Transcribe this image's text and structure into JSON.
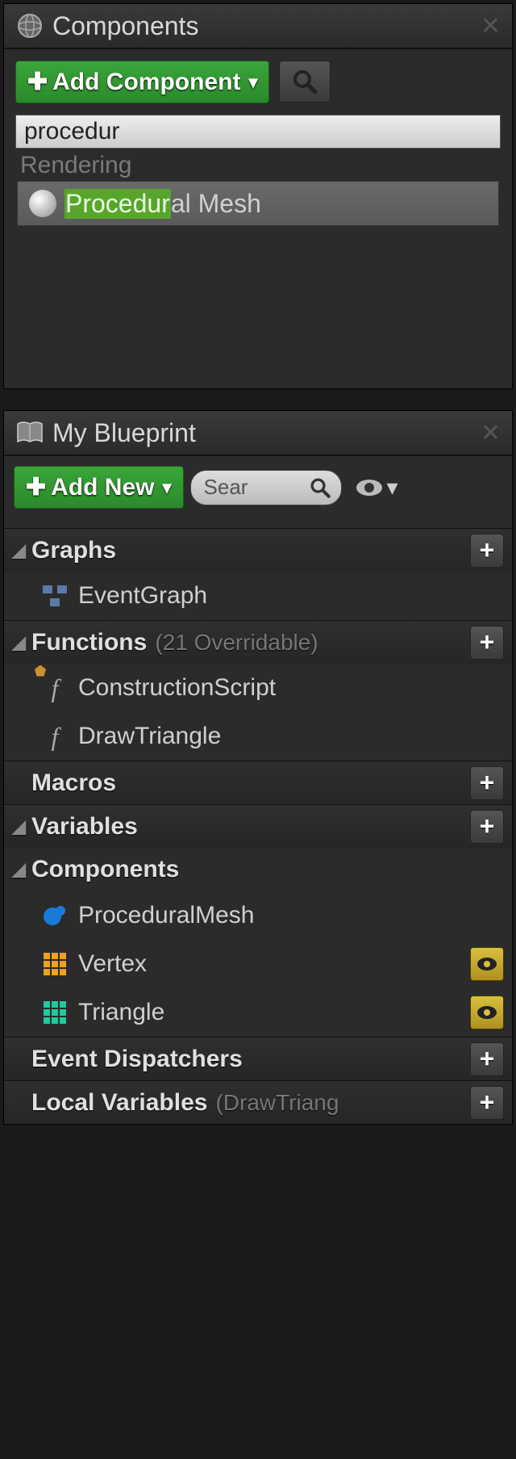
{
  "panels": {
    "components": {
      "title": "Components",
      "add_button": "Add Component",
      "search_value": "procedur",
      "category": "Rendering",
      "result_match": "Procedur",
      "result_rest": "al Mesh"
    },
    "myblueprint": {
      "title": "My Blueprint",
      "add_button": "Add New",
      "search_placeholder": "Sear"
    }
  },
  "categories": {
    "graphs": {
      "label": "Graphs"
    },
    "functions": {
      "label": "Functions",
      "sub": "(21 Overridable)"
    },
    "macros": {
      "label": "Macros"
    },
    "variables": {
      "label": "Variables"
    },
    "components": {
      "label": "Components"
    },
    "event_dispatchers": {
      "label": "Event Dispatchers"
    },
    "local_variables": {
      "label": "Local Variables",
      "sub": "(DrawTriang"
    }
  },
  "items": {
    "eventgraph": "EventGraph",
    "construction": "ConstructionScript",
    "drawtriangle": "DrawTriangle",
    "procmesh": "ProceduralMesh",
    "vertex": "Vertex",
    "triangle": "Triangle"
  }
}
